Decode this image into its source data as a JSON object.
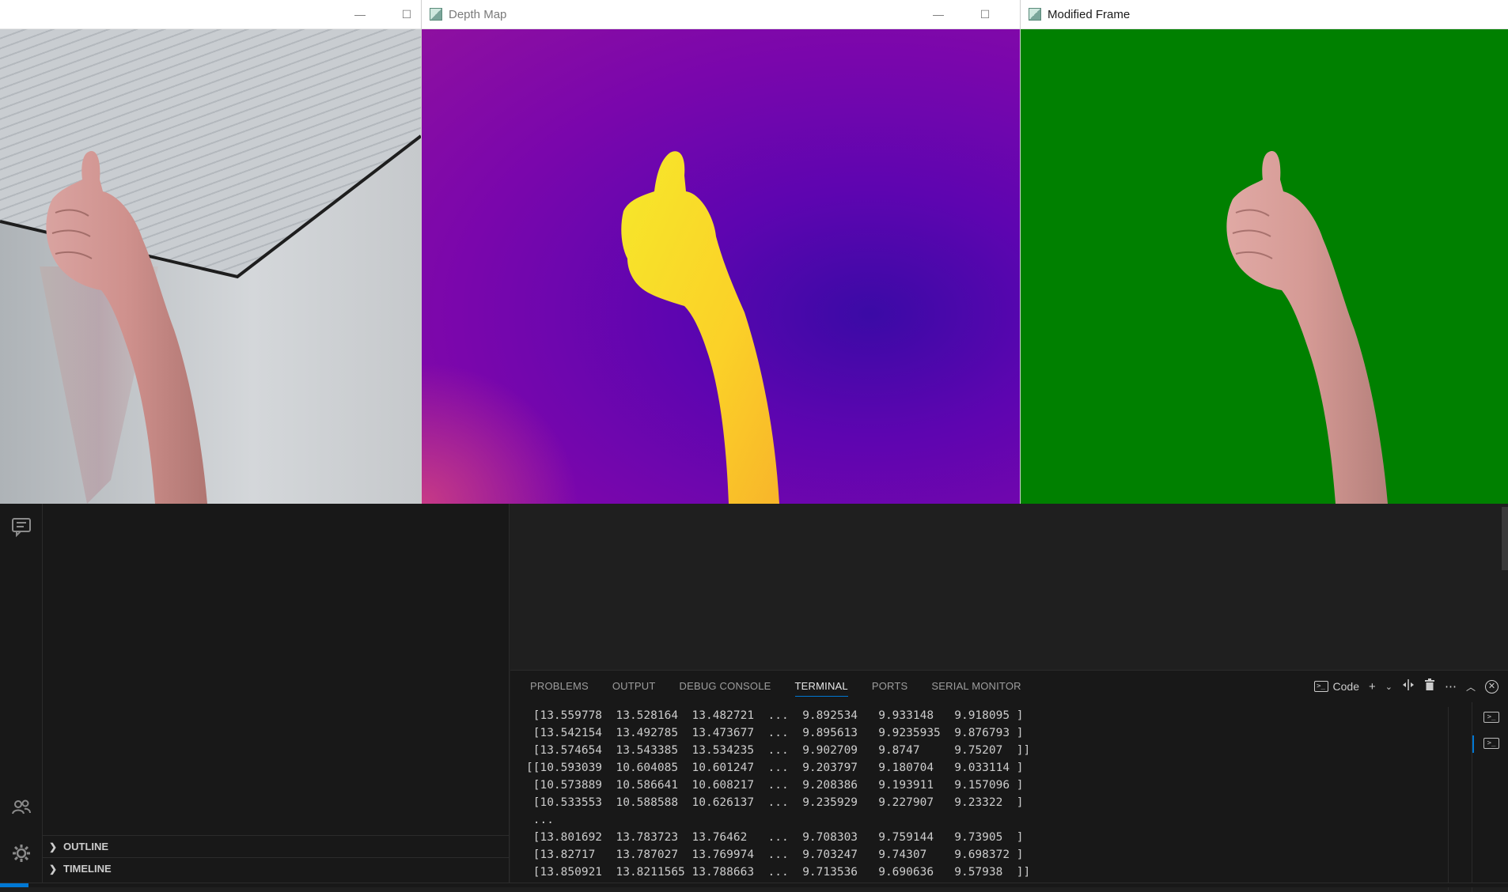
{
  "windows": {
    "original": {
      "title": ""
    },
    "depth": {
      "title": "Depth Map"
    },
    "modified": {
      "title": "Modified Frame"
    }
  },
  "window_controls": {
    "minimize": "—",
    "maximize": "☐"
  },
  "colors": {
    "green_screen": "#008000",
    "depth_low": "#3b0aa6",
    "depth_high": "#f9d230",
    "accent": "#0078d4"
  },
  "activity_bar": {
    "icons": [
      "chat-icon",
      "accounts-icon",
      "settings-gear-icon"
    ]
  },
  "sidebar": {
    "sections": [
      {
        "label": "OUTLINE"
      },
      {
        "label": "TIMELINE"
      }
    ]
  },
  "panel": {
    "tabs": [
      "PROBLEMS",
      "OUTPUT",
      "DEBUG CONSOLE",
      "TERMINAL",
      "PORTS",
      "SERIAL MONITOR"
    ],
    "active_tab": "TERMINAL",
    "terminal_kind": "Code",
    "actions": [
      "new-terminal-icon",
      "dropdown-icon",
      "split-terminal-icon",
      "kill-terminal-icon",
      "more-actions-icon",
      "maximize-panel-icon",
      "close-panel-icon"
    ]
  },
  "terminal": {
    "lines": [
      " [13.559778  13.528164  13.482721  ...  9.892534   9.933148   9.918095 ]",
      " [13.542154  13.492785  13.473677  ...  9.895613   9.9235935  9.876793 ]",
      " [13.574654  13.543385  13.534235  ...  9.902709   9.8747     9.75207  ]]",
      "[[10.593039  10.604085  10.601247  ...  9.203797   9.180704   9.033114 ]",
      " [10.573889  10.586641  10.608217  ...  9.208386   9.193911   9.157096 ]",
      " [10.533553  10.588588  10.626137  ...  9.235929   9.227907   9.23322  ]",
      " ...",
      " [13.801692  13.783723  13.76462   ...  9.708303   9.759144   9.73905  ]",
      " [13.82717   13.787027  13.769974  ...  9.703247   9.74307    9.698372 ]",
      " [13.850921  13.8211565 13.788663  ...  9.713536   9.690636   9.57938  ]]"
    ]
  }
}
